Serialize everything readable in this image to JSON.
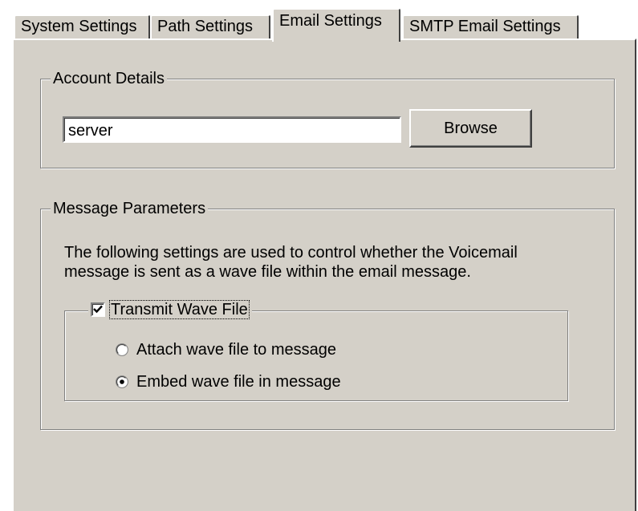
{
  "tabs": [
    {
      "label": "System Settings",
      "active": false
    },
    {
      "label": "Path Settings",
      "active": false
    },
    {
      "label": "Email Settings",
      "active": true
    },
    {
      "label": "SMTP Email Settings",
      "active": false
    }
  ],
  "account_details": {
    "title": "Account Details",
    "server_value": "server",
    "browse_label": "Browse"
  },
  "message_parameters": {
    "title": "Message Parameters",
    "description_line1": "The following settings are used to control whether the Voicemail",
    "description_line2": "message is sent as a wave file within the email message.",
    "transmit_label": "Transmit Wave File",
    "transmit_checked": true,
    "radio_attach_label": "Attach wave file to message",
    "radio_attach_selected": false,
    "radio_embed_label": "Embed wave file in message",
    "radio_embed_selected": true
  },
  "colors": {
    "face": "#d4d0c8",
    "highlight": "#ffffff",
    "shadow": "#808080",
    "dark_shadow": "#404040"
  }
}
